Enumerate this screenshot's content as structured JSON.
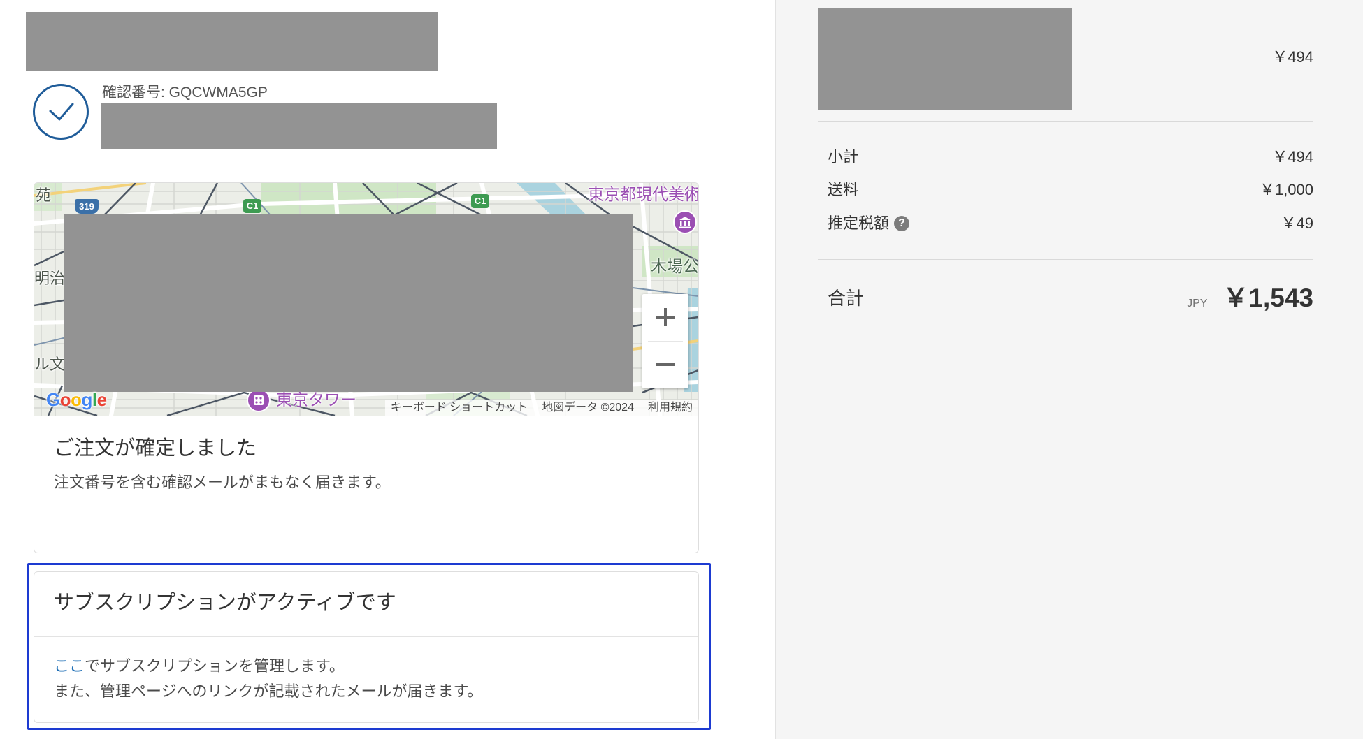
{
  "confirmation": {
    "number_text": "確認番号: GQCWMA5GP"
  },
  "map": {
    "labels": [
      {
        "text": "苑"
      },
      {
        "text": "明治"
      },
      {
        "text": "ル文"
      },
      {
        "text": "東京都現代美術"
      },
      {
        "text": "木場公"
      },
      {
        "text": "東京タワー"
      }
    ],
    "route_badges": [
      {
        "text": "319"
      },
      {
        "text": "C1"
      },
      {
        "text": "C1"
      }
    ],
    "logo": "Google",
    "attribution": {
      "shortcuts": "キーボード ショートカット",
      "map_data": "地図データ ©2024",
      "terms": "利用規約"
    }
  },
  "order_card": {
    "title": "ご注文が確定しました",
    "message": "注文番号を含む確認メールがまもなく届きます。"
  },
  "subscription_card": {
    "title": "サブスクリプションがアクティブです",
    "manage_link": "ここ",
    "manage_text": "でサブスクリプションを管理します。",
    "email_note": "また、管理ページへのリンクが記載されたメールが届きます。"
  },
  "summary": {
    "line_item": {
      "price": "￥494"
    },
    "rows": [
      {
        "label": "小計",
        "value": "￥494"
      },
      {
        "label": "送料",
        "value": "￥1,000"
      },
      {
        "label": "推定税額",
        "value": "￥49",
        "help": "?"
      }
    ],
    "total": {
      "label": "合計",
      "currency": "JPY",
      "value": "￥1,543"
    }
  },
  "icons": {
    "confirmation": "check-circle-icon",
    "help": "question-circle-icon",
    "zoom_in": "plus-icon",
    "zoom_out": "minus-icon",
    "museum_pin": "museum-pin-icon",
    "landmark_pin": "landmark-pin-icon"
  },
  "colors": {
    "check": "#1f5c99",
    "link": "#1f6fb6",
    "highlight_border": "#1d3bd1",
    "redaction": "#939393",
    "summary_background": "#f5f5f5",
    "map_poi": "#9b4fb3",
    "google_logo": [
      "#4285f4",
      "#ea4335",
      "#fbbc05",
      "#4285f4",
      "#34a853",
      "#ea4335"
    ]
  }
}
